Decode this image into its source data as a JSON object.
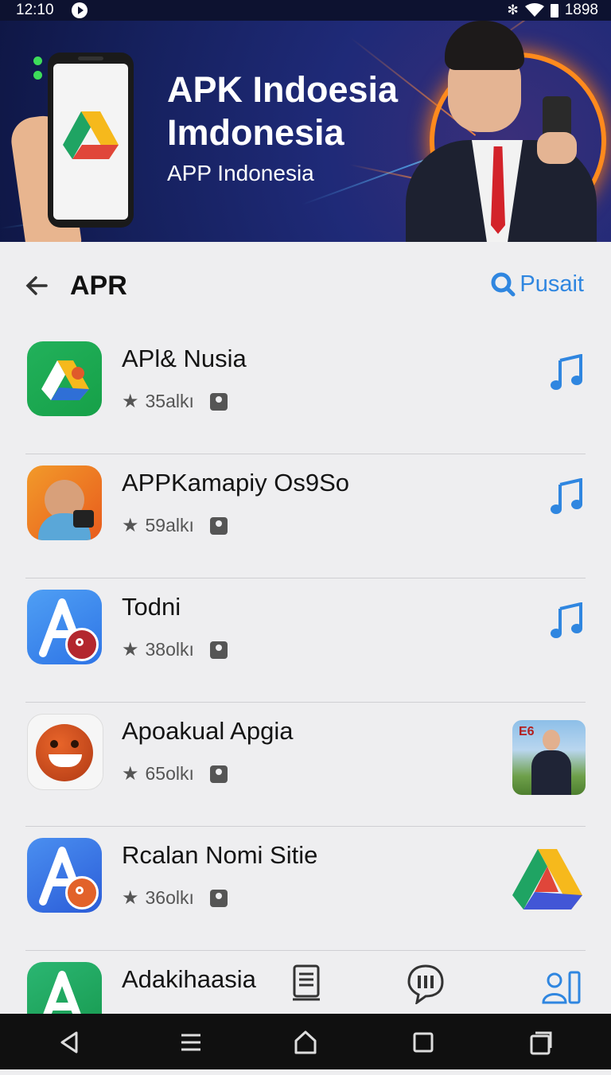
{
  "status_bar": {
    "time": "12:10",
    "battery": "1898"
  },
  "banner": {
    "title_line1": "APK Indoesia",
    "title_line2": "Imdonesia",
    "subtitle": "APP Indonesia"
  },
  "header": {
    "title": "APR",
    "search_label": "Pusait"
  },
  "apps": [
    {
      "name": "APl& Nusia",
      "rating": "35alkı",
      "action": "music-note-icon"
    },
    {
      "name": "APPKamapiy Os9So",
      "rating": "59alkı",
      "action": "music-note-icon"
    },
    {
      "name": "Todni",
      "rating": "38olkı",
      "action": "music-note-icon"
    },
    {
      "name": "Apoakual Apgia",
      "rating": "65olkı",
      "action": "thumbnail-image",
      "thumb_label": "E6"
    },
    {
      "name": "Rcalan Nomi Sitie",
      "rating": "36olkı",
      "action": "drive-triangle-icon"
    },
    {
      "name": "Adakihaasia",
      "rating": ""
    }
  ],
  "colors": {
    "accent": "#2f86e0",
    "banner_bg": "#16215f",
    "ring": "#ff8a1d"
  }
}
